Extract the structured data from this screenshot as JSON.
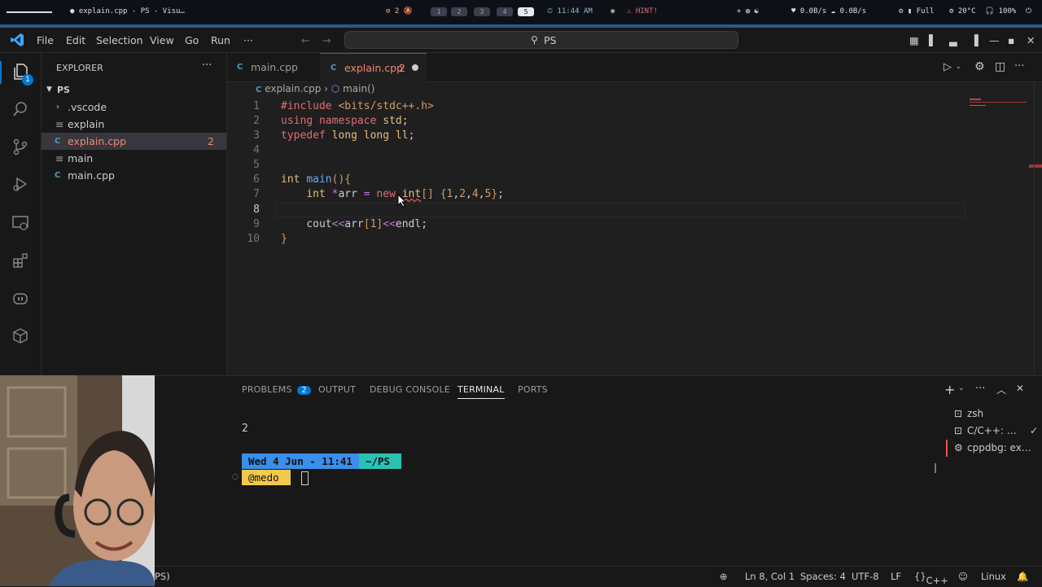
{
  "os_bar": {
    "window_title": "explain.cpp - PS - Visu…",
    "notif_count": "2",
    "workspaces": [
      "1",
      "2",
      "3",
      "4",
      "5"
    ],
    "active_workspace": "5",
    "time": "11:44 AM",
    "hint": "HINT!",
    "network": "0.0B/s ☁ 0.0B/s",
    "battery_label": "Full",
    "weather": "20°C",
    "volume": "100%"
  },
  "titlebar": {
    "menus": [
      "File",
      "Edit",
      "Selection",
      "View",
      "Go",
      "Run",
      "···"
    ],
    "search_text": "PS"
  },
  "activity_bar": {
    "explorer_badge": "1",
    "icons": [
      "files-icon",
      "search-icon",
      "source-control-icon",
      "run-debug-icon",
      "remote-explorer-icon",
      "extensions-icon",
      "copilot-icon",
      "packages-icon"
    ]
  },
  "sidebar": {
    "title": "EXPLORER",
    "more": "···",
    "root": "PS",
    "items": [
      {
        "label": ".vscode",
        "type": "folder"
      },
      {
        "label": "explain",
        "type": "file"
      },
      {
        "label": "explain.cpp",
        "type": "cpp",
        "badge": "2"
      },
      {
        "label": "main",
        "type": "file"
      },
      {
        "label": "main.cpp",
        "type": "cpp"
      }
    ]
  },
  "tabs": {
    "items": [
      {
        "label": "main.cpp"
      },
      {
        "label": "explain.cpp",
        "badge": "2",
        "dirty": true
      }
    ]
  },
  "breadcrumb": {
    "file": "explain.cpp",
    "symbol": "main()"
  },
  "editor": {
    "line_numbers": [
      "1",
      "2",
      "3",
      "4",
      "5",
      "6",
      "7",
      "8",
      "9",
      "10"
    ],
    "current_line": "8",
    "lines": [
      "#include <bits/stdc++.h>",
      "using namespace std;",
      "typedef long long ll;",
      "",
      "",
      "int main(){",
      "    int *arr = new int[] {1,2,4,5};",
      "",
      "    cout<<arr[1]<<endl;",
      "}"
    ]
  },
  "panel": {
    "tabs": [
      "PROBLEMS",
      "OUTPUT",
      "DEBUG CONSOLE",
      "TERMINAL",
      "PORTS"
    ],
    "problems_count": "2",
    "active_tab": "TERMINAL",
    "terminal_output": "2",
    "prompt_date": "Wed  4 Jun - 11:41",
    "prompt_dir": "~/PS",
    "prompt_user": "@medo",
    "terminals": [
      "zsh",
      "C/C++: …",
      "cppdbg: ex…"
    ]
  },
  "statusbar": {
    "left_fragment": "PS)",
    "position": "Ln 8, Col 1",
    "spaces": "Spaces: 4",
    "encoding": "UTF-8",
    "eol": "LF",
    "language": "C++",
    "platform": "Linux"
  },
  "colors": {
    "accent": "#0078d4",
    "cpp_file": "#519aba",
    "error": "#f14c4c",
    "prompt_blue": "#3b8eea",
    "prompt_yellow": "#f2c94c",
    "prompt_teal": "#2bc0b4"
  }
}
